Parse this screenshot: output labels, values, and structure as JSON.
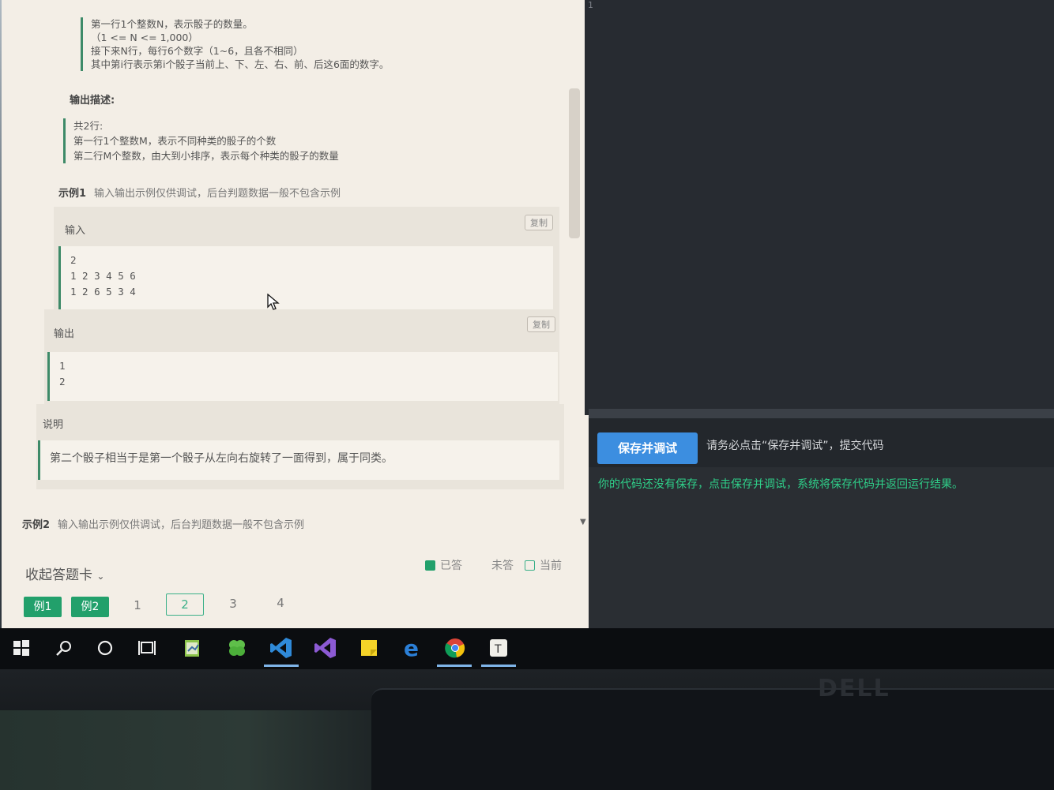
{
  "problem": {
    "input_desc_lines": [
      "第一行1个整数N，表示骰子的数量。",
      "（1 <= N <= 1,000）",
      "接下来N行，每行6个数字（1~6，且各不相同）",
      "其中第i行表示第i个骰子当前上、下、左、右、前、后这6面的数字。"
    ],
    "output_heading": "输出描述:",
    "output_desc_lines": [
      "共2行:",
      "第一行1个整数M，表示不同种类的骰子的个数",
      "第二行M个整数，由大到小排序，表示每个种类的骰子的数量"
    ],
    "example1": {
      "label": "示例1",
      "note": "输入输出示例仅供调试，后台判题数据一般不包含示例",
      "input_title": "输入",
      "copy_label": "复制",
      "input_lines": [
        "2",
        "1 2 3 4 5 6",
        "1 2 6 5 3 4"
      ],
      "output_title": "输出",
      "output_lines": [
        "1",
        "2"
      ],
      "explain_title": "说明",
      "explain_text": "第二个骰子相当于是第一个骰子从左向右旋转了一面得到，属于同类。"
    },
    "example2": {
      "label": "示例2",
      "note": "输入输出示例仅供调试，后台判题数据一般不包含示例"
    }
  },
  "answer_card": {
    "collapse_label": "收起答题卡",
    "legend_answered": "已答",
    "legend_unanswered": "未答",
    "legend_current": "当前",
    "tags": [
      "例1",
      "例2"
    ],
    "numbers": [
      "1",
      "2",
      "3",
      "4"
    ],
    "current_number": "2"
  },
  "editor": {
    "line_number": "1",
    "save_button": "保存并调试",
    "save_hint": "请务必点击“保存并调试”，提交代码",
    "console_message": "你的代码还没有保存，点击保存并调试，系统将保存代码并返回运行结果。"
  },
  "brand": "DELL",
  "colors": {
    "accent_green": "#22a06b",
    "button_blue": "#3c8ee0",
    "console_green": "#2fd08a"
  },
  "taskbar_icons": [
    "windows-start-icon",
    "search-icon",
    "cortana-icon",
    "task-view-icon",
    "notepad-icon",
    "clover-icon",
    "vscode-icon",
    "visual-studio-icon",
    "sticky-notes-icon",
    "edge-icon",
    "chrome-icon",
    "typora-icon"
  ]
}
